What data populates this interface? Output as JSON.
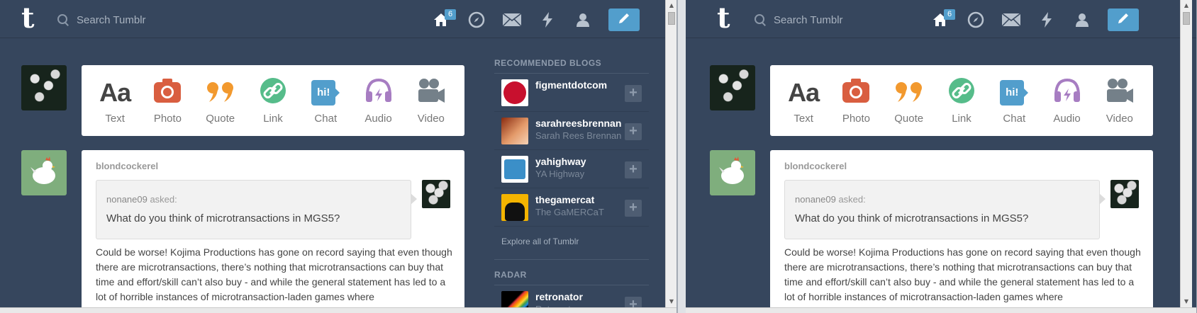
{
  "header": {
    "logo": "t",
    "search_placeholder": "Search Tumblr",
    "dashboard_badge": "6",
    "icons": [
      "home-icon",
      "compass-icon",
      "mail-icon",
      "lightning-icon",
      "person-icon",
      "pencil-icon"
    ]
  },
  "post_types": [
    {
      "label": "Text"
    },
    {
      "label": "Photo"
    },
    {
      "label": "Quote"
    },
    {
      "label": "Link"
    },
    {
      "label": "Chat"
    },
    {
      "label": "Audio"
    },
    {
      "label": "Video"
    }
  ],
  "post_type_glyphs": {
    "text": "Aa",
    "chat": "hi!"
  },
  "post": {
    "author": "blondcockerel",
    "asker": "nonane09",
    "asked_suffix": " asked:",
    "question": "What do you think of microtransactions in MGS5?",
    "answer": "Could be worse! Kojima Productions has gone on record saying that even though there are microtransactions, there’s nothing that microtransactions can buy that time and effort/skill can’t also buy - and while the general statement has led to a lot of horrible instances of microtransaction-laden games where"
  },
  "sidebar": {
    "recommended_title": "RECOMMENDED BLOGS",
    "blogs": [
      {
        "name": "figmentdotcom",
        "sub": ""
      },
      {
        "name": "sarahreesbrennan",
        "sub": "Sarah Rees Brennan"
      },
      {
        "name": "yahighway",
        "sub": "YA Highway"
      },
      {
        "name": "thegamercat",
        "sub": "The GaMERCaT"
      }
    ],
    "explore": "Explore all of Tumblr",
    "radar_title": "RADAR",
    "radar": {
      "name": "retronator",
      "sub": "Retronator"
    },
    "plus": "+"
  },
  "colors": {
    "background": "#36465d",
    "accent": "#529ecc",
    "photo": "#d95e40",
    "quote": "#f2992e",
    "link": "#56bc8a",
    "chat": "#529ecc",
    "audio": "#a77dc2",
    "video": "#748089"
  }
}
